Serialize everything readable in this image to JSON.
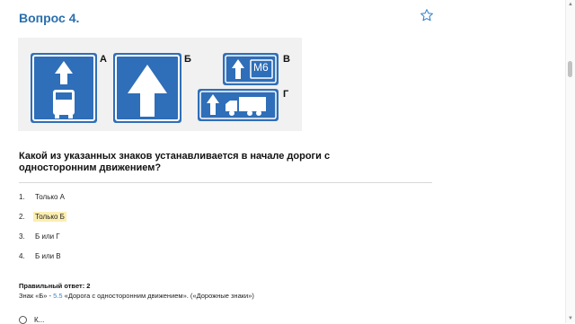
{
  "header": {
    "title": "Вопрос 4."
  },
  "icons": {
    "favorite": "star-outline-icon"
  },
  "signs": {
    "letters": [
      "А",
      "Б",
      "В",
      "Г"
    ],
    "road_label": "М6",
    "colors": {
      "blue": "#2f6eb8",
      "white": "#ffffff"
    }
  },
  "question": {
    "text": "Какой из указанных знаков устанавливается в начале дороги с односторонним движением?"
  },
  "options": [
    {
      "num": "1.",
      "label": "Только А"
    },
    {
      "num": "2.",
      "label": "Только Б"
    },
    {
      "num": "3.",
      "label": "Б или Г"
    },
    {
      "num": "4.",
      "label": "Б или В"
    }
  ],
  "answer": {
    "label": "Правильный ответ: 2",
    "prefix": "Знак «Б» - ",
    "link": "5.5",
    "suffix": " «Дорога с односторонним движением». («Дорожные знаки»)"
  },
  "bottom": {
    "text": "К..."
  }
}
